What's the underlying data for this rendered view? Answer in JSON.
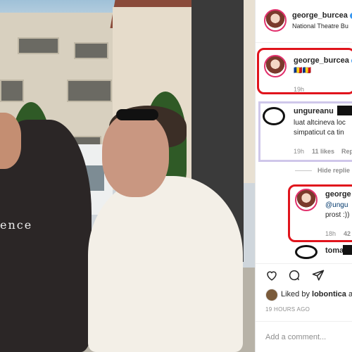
{
  "post": {
    "author": "george_burcea",
    "location": "National Theatre Bu",
    "photo_shirt_text": "ence"
  },
  "caption": {
    "author": "george_burcea",
    "emojis": "🇷🇴🇷🇴",
    "time": "19h"
  },
  "comment1": {
    "author": "ungureanu",
    "line1": "luat altcineva loc",
    "line2": "simpaticut ca tin",
    "time": "19h",
    "likes": "11 likes",
    "reply": "Reply",
    "hide_replies": "Hide replie"
  },
  "reply1": {
    "author": "george",
    "mention": "@ungu",
    "text": "prost :))",
    "time": "18h",
    "likes": "42"
  },
  "comment2": {
    "author": "toma"
  },
  "footer": {
    "liked_prefix": "Liked by ",
    "liked_user": "lobontica",
    "liked_suffix": " a",
    "timestamp": "19 HOURS AGO",
    "add_comment_placeholder": "Add a comment..."
  },
  "icons": [
    "heart-icon",
    "comment-icon",
    "share-icon"
  ],
  "colors": {
    "highlight_red": "#e0141c",
    "highlight_purple": "#cfc7ea",
    "verified_blue": "#3897f0"
  }
}
